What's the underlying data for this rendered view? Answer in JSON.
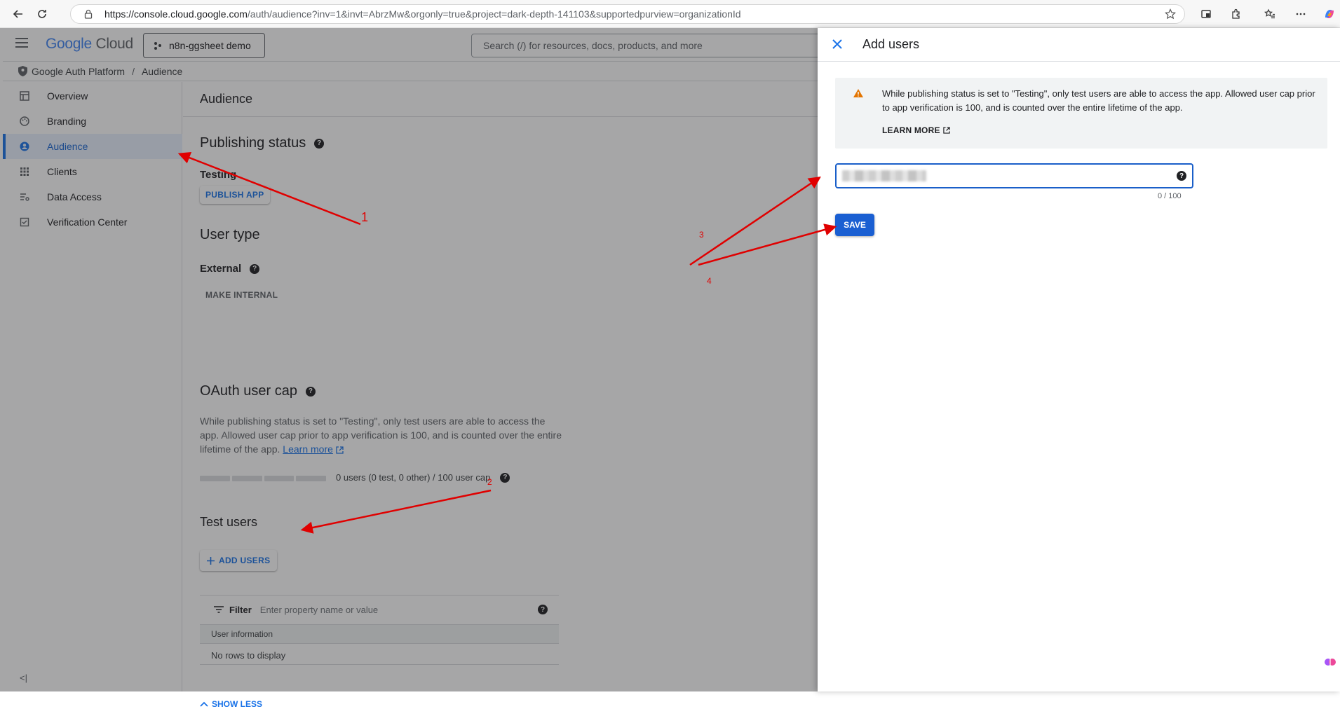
{
  "browser": {
    "url_host": "https://console.cloud.google.com",
    "url_path": "/auth/audience?inv=1&invt=AbrzMw&orgonly=true&project=dark-depth-141103&supportedpurview=organizationId"
  },
  "topbar": {
    "logo_google": "Google",
    "logo_cloud": "Cloud",
    "project": "n8n-ggsheet demo",
    "search_placeholder": "Search (/) for resources, docs, products, and more"
  },
  "breadcrumb": {
    "platform": "Google Auth Platform",
    "separator": "/",
    "page": "Audience"
  },
  "sidebar": {
    "items": [
      {
        "label": "Overview",
        "icon": "dashboard-icon"
      },
      {
        "label": "Branding",
        "icon": "palette-icon"
      },
      {
        "label": "Audience",
        "icon": "person-icon",
        "active": true
      },
      {
        "label": "Clients",
        "icon": "grid-icon"
      },
      {
        "label": "Data Access",
        "icon": "data-access-icon"
      },
      {
        "label": "Verification Center",
        "icon": "checkbox-icon"
      }
    ],
    "collapse_label": "<|"
  },
  "main": {
    "page_title": "Audience",
    "publishing_status": {
      "heading": "Publishing status",
      "status": "Testing",
      "button": "PUBLISH APP"
    },
    "user_type": {
      "heading": "User type",
      "value": "External",
      "button": "MAKE INTERNAL"
    },
    "oauth_cap": {
      "heading": "OAuth user cap",
      "text": "While publishing status is set to \"Testing\", only test users are able to access the app. Allowed user cap prior to app verification is 100, and is counted over the entire lifetime of the app.",
      "link": "Learn more",
      "cap_text": "0 users (0 test, 0 other) / 100 user cap",
      "cap_fraction": 0
    },
    "test_users": {
      "heading": "Test users",
      "add_button": "ADD USERS",
      "filter_label": "Filter",
      "filter_placeholder": "Enter property name or value",
      "column": "User information",
      "empty": "No rows to display",
      "show_less": "SHOW LESS"
    }
  },
  "panel": {
    "title": "Add users",
    "warning": "While publishing status is set to \"Testing\", only test users are able to access the app. Allowed user cap prior to app verification is 100, and is counted over the entire lifetime of the app.",
    "learn_more": "LEARN MORE",
    "counter": "0 / 100",
    "save": "SAVE"
  },
  "annotations": [
    "1",
    "2",
    "3",
    "4"
  ],
  "colors": {
    "accent": "#1a73e8",
    "save_button": "#1a5fd2",
    "warning": "#e37400",
    "annotation": "#e00000"
  }
}
